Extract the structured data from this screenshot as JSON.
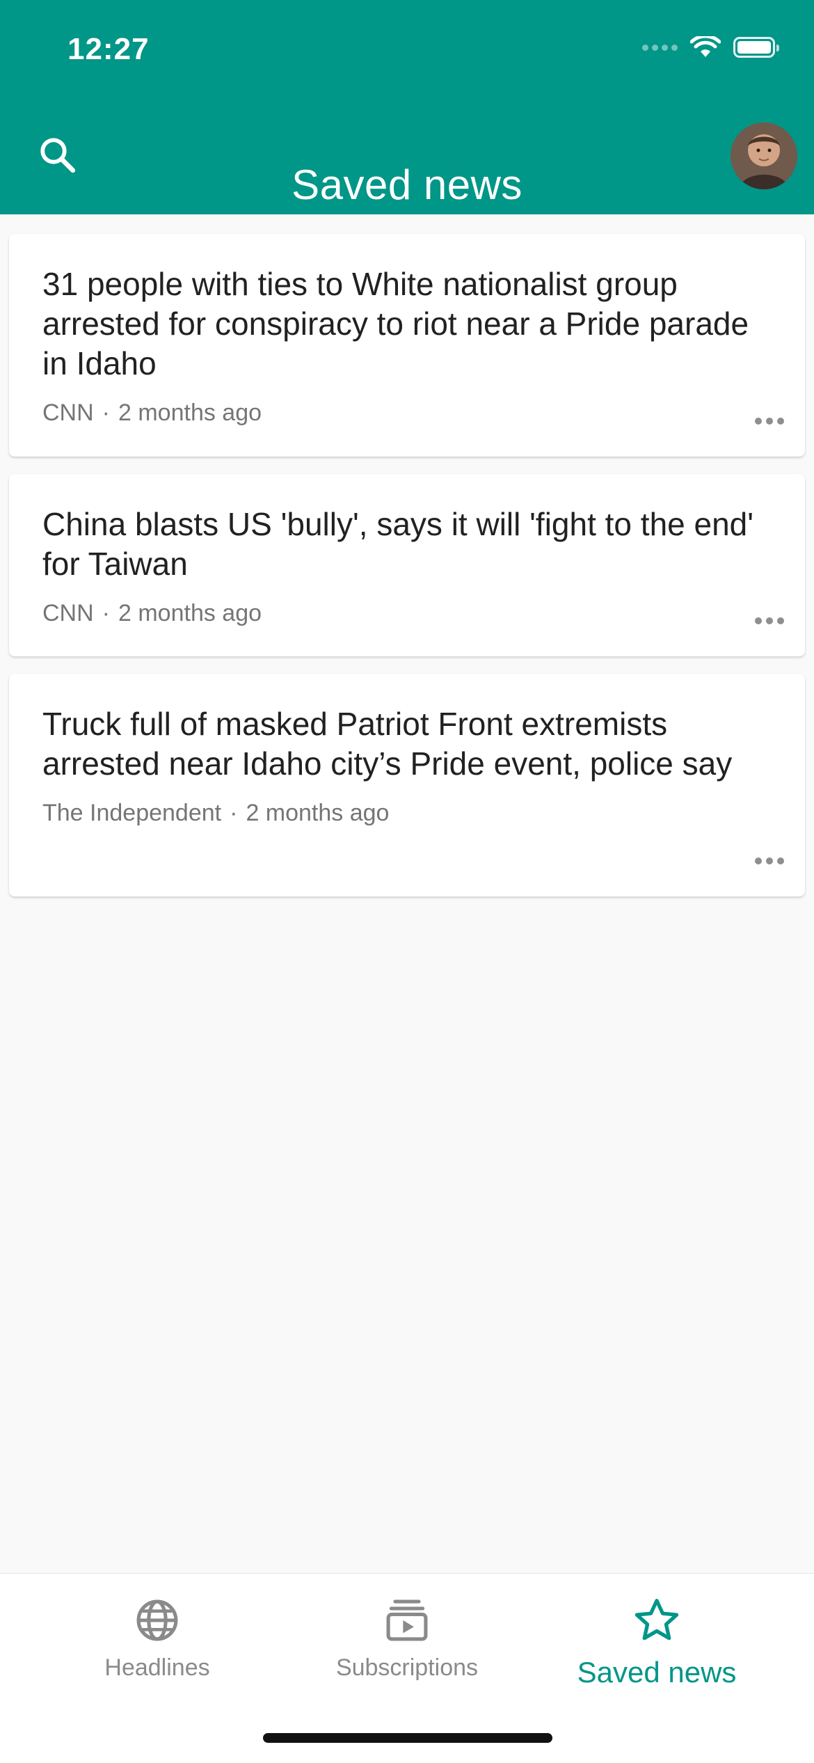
{
  "status_bar": {
    "time": "12:27"
  },
  "header": {
    "title": "Saved news",
    "search_icon": "search-icon",
    "avatar_icon": "user-avatar"
  },
  "articles": [
    {
      "title": "31 people with ties to White nationalist group arrested for conspiracy to riot near a Pride parade in Idaho",
      "source": "CNN",
      "separator": "·",
      "time": "2 months ago"
    },
    {
      "title": "China blasts US 'bully', says it will 'fight to the end' for Taiwan",
      "source": "CNN",
      "separator": "·",
      "time": "2 months ago"
    },
    {
      "title": "Truck full of masked Patriot Front extremists arrested near Idaho city’s Pride event, police say",
      "source": "The Independent",
      "separator": "·",
      "time": "2 months ago"
    }
  ],
  "bottom_nav": {
    "items": [
      {
        "label": "Headlines",
        "icon": "globe-icon",
        "active": false
      },
      {
        "label": "Subscriptions",
        "icon": "subscriptions-icon",
        "active": false
      },
      {
        "label": "Saved news",
        "icon": "star-outline-icon",
        "active": true
      }
    ]
  },
  "colors": {
    "primary": "#009688",
    "background": "#f9f9f9",
    "card": "#ffffff",
    "title_text": "#212121",
    "meta_text": "#757575",
    "inactive_nav": "#8a8a8a"
  }
}
